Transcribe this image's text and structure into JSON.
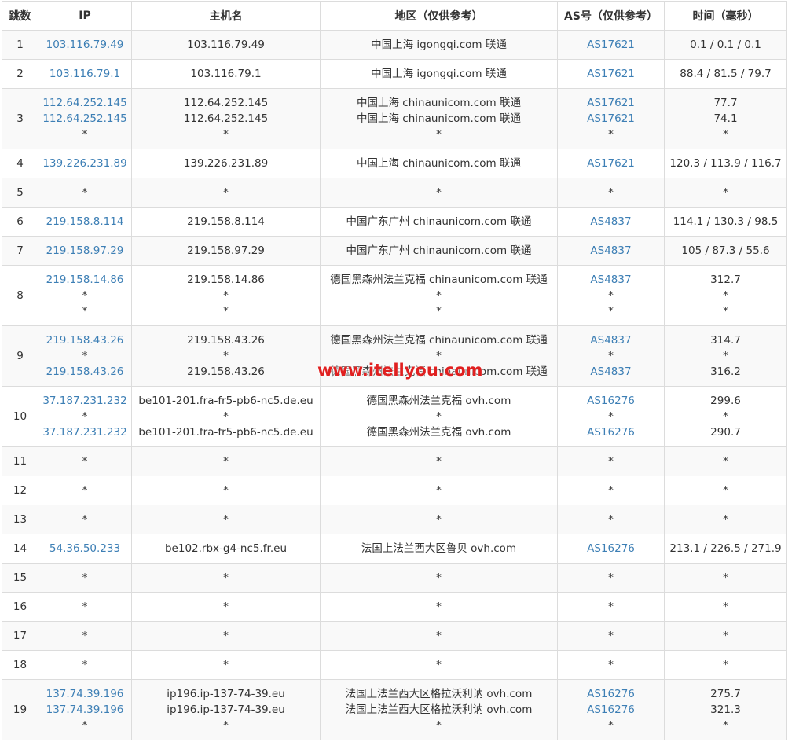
{
  "headers": {
    "hop": "跳数",
    "ip": "IP",
    "host": "主机名",
    "region": "地区（仅供参考）",
    "as": "AS号（仅供参考）",
    "time": "时间（毫秒）"
  },
  "watermark": "www.itellyou.com",
  "rows": [
    {
      "hop": "1",
      "ip": [
        "103.116.79.49"
      ],
      "host": [
        "103.116.79.49"
      ],
      "region": [
        "中国上海 igongqi.com 联通"
      ],
      "as": [
        "AS17621"
      ],
      "time": [
        "0.1 / 0.1 / 0.1"
      ]
    },
    {
      "hop": "2",
      "ip": [
        "103.116.79.1"
      ],
      "host": [
        "103.116.79.1"
      ],
      "region": [
        "中国上海 igongqi.com 联通"
      ],
      "as": [
        "AS17621"
      ],
      "time": [
        "88.4 / 81.5 / 79.7"
      ]
    },
    {
      "hop": "3",
      "ip": [
        "112.64.252.145",
        "112.64.252.145",
        "*"
      ],
      "host": [
        "112.64.252.145",
        "112.64.252.145",
        "*"
      ],
      "region": [
        "中国上海 chinaunicom.com 联通",
        "中国上海 chinaunicom.com 联通",
        "*"
      ],
      "as": [
        "AS17621",
        "AS17621",
        "*"
      ],
      "time": [
        "77.7",
        "74.1",
        "*"
      ]
    },
    {
      "hop": "4",
      "ip": [
        "139.226.231.89"
      ],
      "host": [
        "139.226.231.89"
      ],
      "region": [
        "中国上海 chinaunicom.com 联通"
      ],
      "as": [
        "AS17621"
      ],
      "time": [
        "120.3 / 113.9 / 116.7"
      ]
    },
    {
      "hop": "5",
      "ip": [
        "*"
      ],
      "host": [
        "*"
      ],
      "region": [
        "*"
      ],
      "as": [
        "*"
      ],
      "time": [
        "*"
      ]
    },
    {
      "hop": "6",
      "ip": [
        "219.158.8.114"
      ],
      "host": [
        "219.158.8.114"
      ],
      "region": [
        "中国广东广州 chinaunicom.com 联通"
      ],
      "as": [
        "AS4837"
      ],
      "time": [
        "114.1 / 130.3 / 98.5"
      ]
    },
    {
      "hop": "7",
      "ip": [
        "219.158.97.29"
      ],
      "host": [
        "219.158.97.29"
      ],
      "region": [
        "中国广东广州 chinaunicom.com 联通"
      ],
      "as": [
        "AS4837"
      ],
      "time": [
        "105 / 87.3 / 55.6"
      ]
    },
    {
      "hop": "8",
      "ip": [
        "219.158.14.86",
        "*",
        "*"
      ],
      "host": [
        "219.158.14.86",
        "*",
        "*"
      ],
      "region": [
        "德国黑森州法兰克福 chinaunicom.com 联通",
        "*",
        "*"
      ],
      "as": [
        "AS4837",
        "*",
        "*"
      ],
      "time": [
        "312.7",
        "*",
        "*"
      ]
    },
    {
      "hop": "9",
      "ip": [
        "219.158.43.26",
        "*",
        "219.158.43.26"
      ],
      "host": [
        "219.158.43.26",
        "*",
        "219.158.43.26"
      ],
      "region": [
        "德国黑森州法兰克福 chinaunicom.com 联通",
        "*",
        "德国黑森州法兰克福 chinaunicom.com 联通"
      ],
      "as": [
        "AS4837",
        "*",
        "AS4837"
      ],
      "time": [
        "314.7",
        "*",
        "316.2"
      ]
    },
    {
      "hop": "10",
      "ip": [
        "37.187.231.232",
        "*",
        "37.187.231.232"
      ],
      "host": [
        "be101-201.fra-fr5-pb6-nc5.de.eu",
        "*",
        "be101-201.fra-fr5-pb6-nc5.de.eu"
      ],
      "region": [
        "德国黑森州法兰克福 ovh.com",
        "*",
        "德国黑森州法兰克福 ovh.com"
      ],
      "as": [
        "AS16276",
        "*",
        "AS16276"
      ],
      "time": [
        "299.6",
        "*",
        "290.7"
      ]
    },
    {
      "hop": "11",
      "ip": [
        "*"
      ],
      "host": [
        "*"
      ],
      "region": [
        "*"
      ],
      "as": [
        "*"
      ],
      "time": [
        "*"
      ]
    },
    {
      "hop": "12",
      "ip": [
        "*"
      ],
      "host": [
        "*"
      ],
      "region": [
        "*"
      ],
      "as": [
        "*"
      ],
      "time": [
        "*"
      ]
    },
    {
      "hop": "13",
      "ip": [
        "*"
      ],
      "host": [
        "*"
      ],
      "region": [
        "*"
      ],
      "as": [
        "*"
      ],
      "time": [
        "*"
      ]
    },
    {
      "hop": "14",
      "ip": [
        "54.36.50.233"
      ],
      "host": [
        "be102.rbx-g4-nc5.fr.eu"
      ],
      "region": [
        "法国上法兰西大区鲁贝 ovh.com"
      ],
      "as": [
        "AS16276"
      ],
      "time": [
        "213.1 / 226.5 / 271.9"
      ]
    },
    {
      "hop": "15",
      "ip": [
        "*"
      ],
      "host": [
        "*"
      ],
      "region": [
        "*"
      ],
      "as": [
        "*"
      ],
      "time": [
        "*"
      ]
    },
    {
      "hop": "16",
      "ip": [
        "*"
      ],
      "host": [
        "*"
      ],
      "region": [
        "*"
      ],
      "as": [
        "*"
      ],
      "time": [
        "*"
      ]
    },
    {
      "hop": "17",
      "ip": [
        "*"
      ],
      "host": [
        "*"
      ],
      "region": [
        "*"
      ],
      "as": [
        "*"
      ],
      "time": [
        "*"
      ]
    },
    {
      "hop": "18",
      "ip": [
        "*"
      ],
      "host": [
        "*"
      ],
      "region": [
        "*"
      ],
      "as": [
        "*"
      ],
      "time": [
        "*"
      ]
    },
    {
      "hop": "19",
      "ip": [
        "137.74.39.196",
        "137.74.39.196",
        "*"
      ],
      "host": [
        "ip196.ip-137-74-39.eu",
        "ip196.ip-137-74-39.eu",
        "*"
      ],
      "region": [
        "法国上法兰西大区格拉沃利讷 ovh.com",
        "法国上法兰西大区格拉沃利讷 ovh.com",
        "*"
      ],
      "as": [
        "AS16276",
        "AS16276",
        "*"
      ],
      "time": [
        "275.7",
        "321.3",
        "*"
      ]
    }
  ],
  "colors": {
    "link": "#3d7fb5",
    "border": "#dcdcdc",
    "stripe": "#f9f9f9",
    "watermark": "#e02020"
  }
}
